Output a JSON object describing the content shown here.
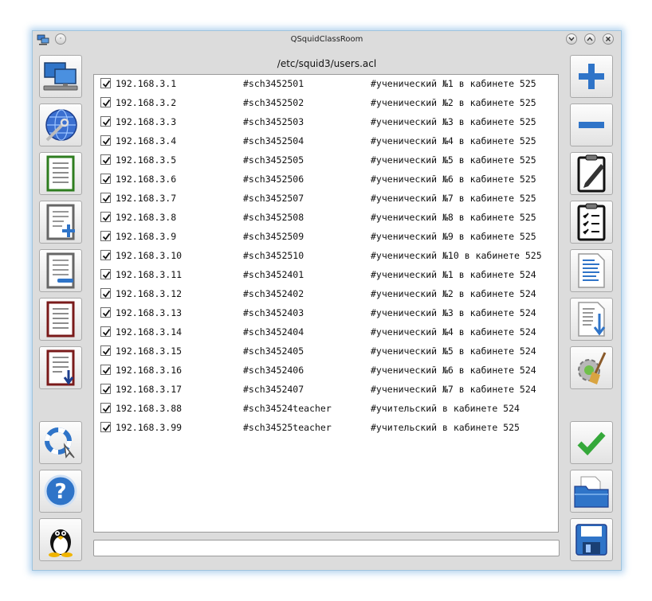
{
  "window": {
    "title": "QSquidClassRoom"
  },
  "file_path": "/etc/squid3/users.acl",
  "left_toolbar": [
    {
      "name": "network-clients-icon"
    },
    {
      "name": "web-settings-icon"
    },
    {
      "name": "list-green-icon"
    },
    {
      "name": "list-add-icon"
    },
    {
      "name": "list-edit-icon"
    },
    {
      "name": "list-red-icon"
    },
    {
      "name": "list-download-icon"
    },
    {
      "name": "help-search-icon"
    },
    {
      "name": "help-icon"
    },
    {
      "name": "about-tux-icon"
    }
  ],
  "right_toolbar": [
    {
      "name": "add-icon"
    },
    {
      "name": "remove-icon"
    },
    {
      "name": "edit-icon"
    },
    {
      "name": "checklist-icon"
    },
    {
      "name": "text-file-icon"
    },
    {
      "name": "file-download-icon"
    },
    {
      "name": "clean-settings-icon"
    },
    {
      "name": "apply-checkmark-icon"
    },
    {
      "name": "open-folder-icon"
    },
    {
      "name": "save-floppy-icon"
    }
  ],
  "acl_rows": [
    {
      "checked": true,
      "ip": "192.168.3.1",
      "name": "#sch3452501",
      "desc": "#ученический №1 в кабинете 525"
    },
    {
      "checked": true,
      "ip": "192.168.3.2",
      "name": "#sch3452502",
      "desc": "#ученический №2 в кабинете 525"
    },
    {
      "checked": true,
      "ip": "192.168.3.3",
      "name": "#sch3452503",
      "desc": "#ученический №3 в кабинете 525"
    },
    {
      "checked": true,
      "ip": "192.168.3.4",
      "name": "#sch3452504",
      "desc": "#ученический №4 в кабинете 525"
    },
    {
      "checked": true,
      "ip": "192.168.3.5",
      "name": "#sch3452505",
      "desc": "#ученический №5 в кабинете 525"
    },
    {
      "checked": true,
      "ip": "192.168.3.6",
      "name": "#sch3452506",
      "desc": "#ученический №6 в кабинете 525"
    },
    {
      "checked": true,
      "ip": "192.168.3.7",
      "name": "#sch3452507",
      "desc": "#ученический №7 в кабинете 525"
    },
    {
      "checked": true,
      "ip": "192.168.3.8",
      "name": "#sch3452508",
      "desc": "#ученический №8 в кабинете 525"
    },
    {
      "checked": true,
      "ip": "192.168.3.9",
      "name": "#sch3452509",
      "desc": "#ученический №9 в кабинете 525"
    },
    {
      "checked": true,
      "ip": "192.168.3.10",
      "name": "#sch3452510",
      "desc": "#ученический №10 в кабинете 525"
    },
    {
      "checked": true,
      "ip": "192.168.3.11",
      "name": "#sch3452401",
      "desc": "#ученический №1 в кабинете 524"
    },
    {
      "checked": true,
      "ip": "192.168.3.12",
      "name": "#sch3452402",
      "desc": "#ученический №2 в кабинете 524"
    },
    {
      "checked": true,
      "ip": "192.168.3.13",
      "name": "#sch3452403",
      "desc": "#ученический №3 в кабинете 524"
    },
    {
      "checked": true,
      "ip": "192.168.3.14",
      "name": "#sch3452404",
      "desc": "#ученический №4 в кабинете 524"
    },
    {
      "checked": true,
      "ip": "192.168.3.15",
      "name": "#sch3452405",
      "desc": "#ученический №5 в кабинете 524"
    },
    {
      "checked": true,
      "ip": "192.168.3.16",
      "name": "#sch3452406",
      "desc": "#ученический №6 в кабинете 524"
    },
    {
      "checked": true,
      "ip": "192.168.3.17",
      "name": "#sch3452407",
      "desc": "#ученический №7 в кабинете 524"
    },
    {
      "checked": true,
      "ip": "192.168.3.88",
      "name": "#sch34524teacher",
      "desc": "#учительский в кабинете 524"
    },
    {
      "checked": true,
      "ip": "192.168.3.99",
      "name": "#sch34525teacher",
      "desc": "#учительский в кабинете 525"
    }
  ],
  "status_input": {
    "value": ""
  },
  "colors": {
    "accent_blue": "#2f74c8",
    "check_green": "#35a83a",
    "window_bg": "#dcdcdc",
    "glow": "#5aa0dc"
  }
}
